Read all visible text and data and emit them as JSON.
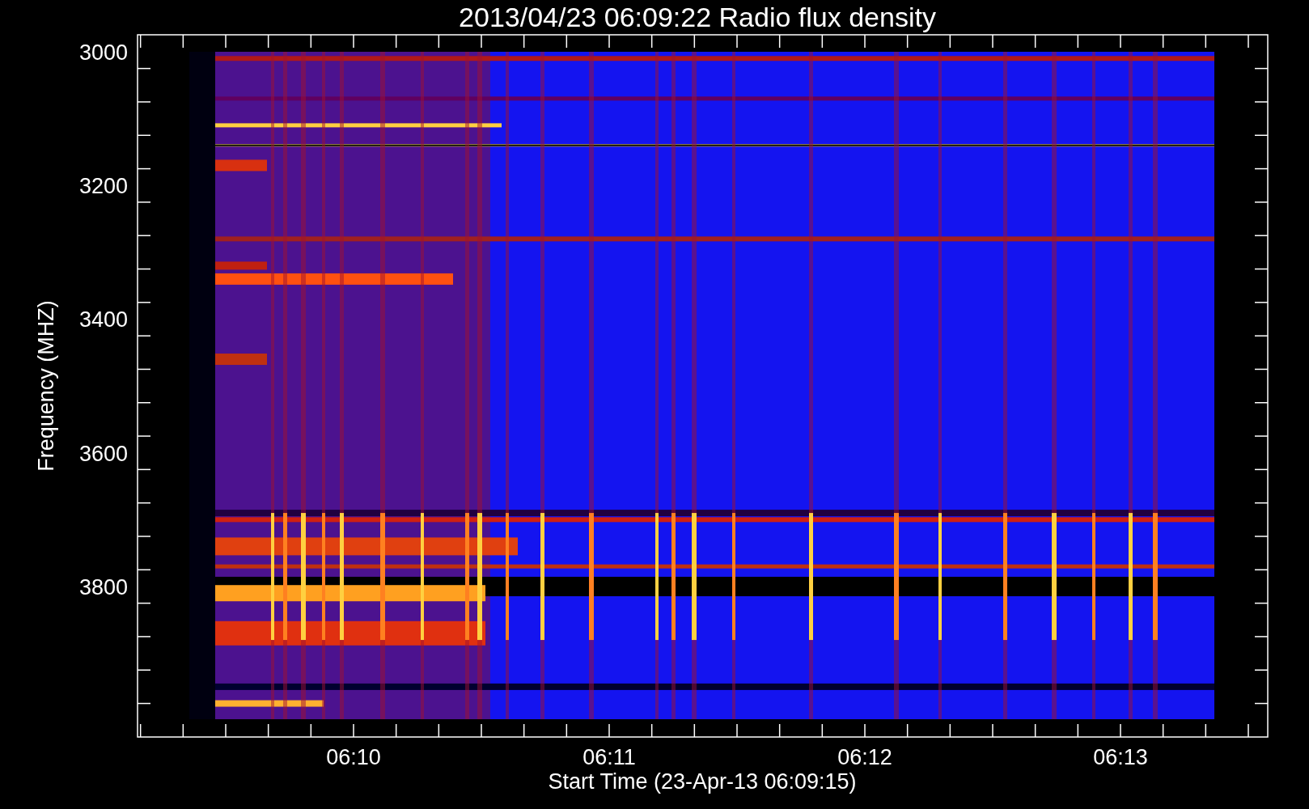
{
  "title": "2013/04/23 06:09:22 Radio flux density",
  "ylabel": "Frequency (MHZ)",
  "xlabel": "Start Time (23-Apr-13 06:09:15)",
  "yticks": [
    "3000",
    "3200",
    "3400",
    "3600",
    "3800"
  ],
  "xticks": [
    "06:10",
    "06:11",
    "06:12",
    "06:13"
  ]
}
